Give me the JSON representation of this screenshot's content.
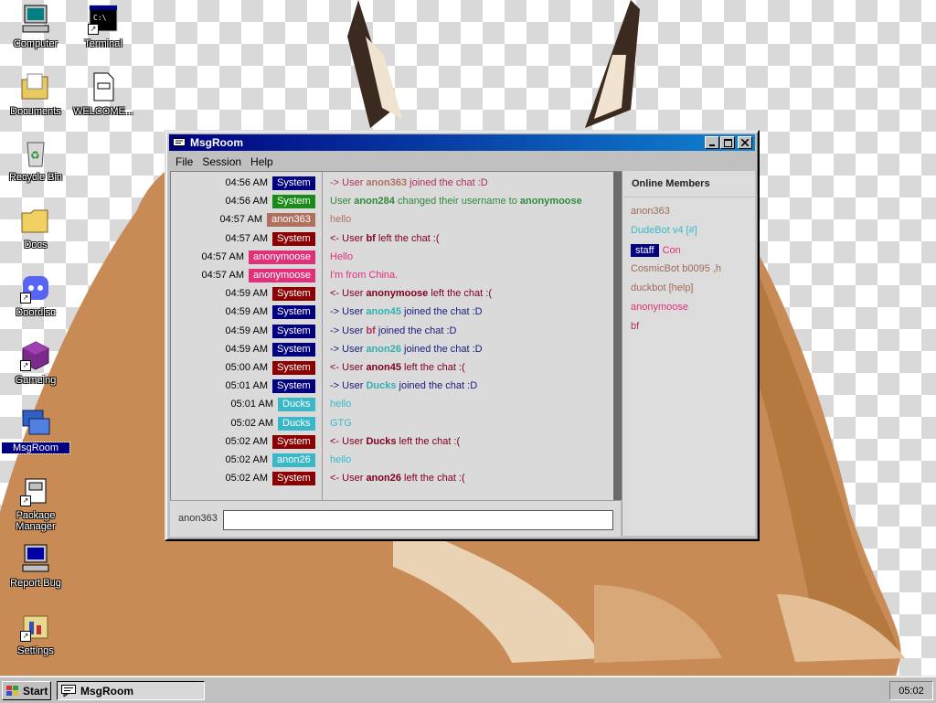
{
  "desktop": {
    "icons": [
      {
        "label": "Computer",
        "icon": "computer-icon",
        "shortcut": false
      },
      {
        "label": "Terminal",
        "icon": "terminal-icon",
        "shortcut": true
      },
      {
        "label": "Documents",
        "icon": "documents-folder-icon",
        "shortcut": false
      },
      {
        "label": "WELCOME...",
        "icon": "text-file-icon",
        "shortcut": false
      },
      {
        "label": "Recycle Bin",
        "icon": "recycle-bin-icon",
        "shortcut": false
      },
      {
        "label": "Docs",
        "icon": "folder-icon",
        "shortcut": false
      },
      {
        "label": "Doordisc",
        "icon": "doordisc-icon",
        "shortcut": true
      },
      {
        "label": "Gameing",
        "icon": "game-cube-icon",
        "shortcut": true
      },
      {
        "label": "MsgRoom",
        "icon": "msgroom-icon",
        "shortcut": false
      },
      {
        "label": "Package Manager",
        "icon": "package-manager-icon",
        "shortcut": true
      },
      {
        "label": "Report Bug",
        "icon": "report-bug-icon",
        "shortcut": false
      },
      {
        "label": "Settings",
        "icon": "settings-icon",
        "shortcut": true
      }
    ]
  },
  "window": {
    "title": "MsgRoom",
    "menu": [
      "File",
      "Session",
      "Help"
    ],
    "messages": [
      {
        "time": "04:56 AM",
        "user": "System",
        "badge_color": "#000080",
        "parts": [
          [
            "-> User ",
            "#b0305a",
            false
          ],
          [
            "anon363",
            "#b07060",
            true
          ],
          [
            " joined the chat :D",
            "#b0305a",
            false
          ]
        ]
      },
      {
        "time": "04:56 AM",
        "user": "System",
        "badge_color": "#1a8a1a",
        "parts": [
          [
            "User ",
            "#2e8b3a",
            false
          ],
          [
            "anon284",
            "#2e8b3a",
            true
          ],
          [
            " changed their username to ",
            "#2e8b3a",
            false
          ],
          [
            "anonymoose",
            "#2e8b3a",
            true
          ]
        ]
      },
      {
        "time": "04:57 AM",
        "user": "anon363",
        "badge_color": "#b07060",
        "parts": [
          [
            "hello",
            "#b07060",
            false
          ]
        ]
      },
      {
        "time": "04:57 AM",
        "user": "System",
        "badge_color": "#8b0000",
        "parts": [
          [
            "<- User ",
            "#800020",
            false
          ],
          [
            "bf",
            "#800020",
            true
          ],
          [
            " left the chat :(",
            "#800020",
            false
          ]
        ]
      },
      {
        "time": "04:57 AM",
        "user": "anonymoose",
        "badge_color": "#e0307a",
        "parts": [
          [
            "Hello",
            "#e0307a",
            false
          ]
        ]
      },
      {
        "time": "04:57 AM",
        "user": "anonymoose",
        "badge_color": "#e0307a",
        "parts": [
          [
            "I'm from China.",
            "#e0307a",
            false
          ]
        ]
      },
      {
        "time": "04:59 AM",
        "user": "System",
        "badge_color": "#8b0000",
        "parts": [
          [
            "<- User ",
            "#800020",
            false
          ],
          [
            "anonymoose",
            "#800020",
            true
          ],
          [
            " left the chat :(",
            "#800020",
            false
          ]
        ]
      },
      {
        "time": "04:59 AM",
        "user": "System",
        "badge_color": "#000080",
        "parts": [
          [
            "-> User ",
            "#1a1a80",
            false
          ],
          [
            "anon45",
            "#30b0b0",
            true
          ],
          [
            " joined the chat :D",
            "#1a1a80",
            false
          ]
        ]
      },
      {
        "time": "04:59 AM",
        "user": "System",
        "badge_color": "#000080",
        "parts": [
          [
            "-> User ",
            "#1a1a80",
            false
          ],
          [
            "bf",
            "#b0305a",
            true
          ],
          [
            " joined the chat :D",
            "#1a1a80",
            false
          ]
        ]
      },
      {
        "time": "04:59 AM",
        "user": "System",
        "badge_color": "#000080",
        "parts": [
          [
            "-> User ",
            "#1a1a80",
            false
          ],
          [
            "anon26",
            "#30b0b0",
            true
          ],
          [
            " joined the chat :D",
            "#1a1a80",
            false
          ]
        ]
      },
      {
        "time": "05:00 AM",
        "user": "System",
        "badge_color": "#8b0000",
        "parts": [
          [
            "<- User ",
            "#800020",
            false
          ],
          [
            "anon45",
            "#800020",
            true
          ],
          [
            " left the chat :(",
            "#800020",
            false
          ]
        ]
      },
      {
        "time": "05:01 AM",
        "user": "System",
        "badge_color": "#000080",
        "parts": [
          [
            "-> User ",
            "#1a1a80",
            false
          ],
          [
            "Ducks",
            "#30b0b0",
            true
          ],
          [
            " joined the chat :D",
            "#1a1a80",
            false
          ]
        ]
      },
      {
        "time": "05:01 AM",
        "user": "Ducks",
        "badge_color": "#3ab8c8",
        "parts": [
          [
            "hello",
            "#3ab8c8",
            false
          ]
        ]
      },
      {
        "time": "05:02 AM",
        "user": "Ducks",
        "badge_color": "#3ab8c8",
        "parts": [
          [
            "GTG",
            "#3ab8c8",
            false
          ]
        ]
      },
      {
        "time": "05:02 AM",
        "user": "System",
        "badge_color": "#8b0000",
        "parts": [
          [
            "<- User ",
            "#800020",
            false
          ],
          [
            "Ducks",
            "#800020",
            true
          ],
          [
            " left the chat :(",
            "#800020",
            false
          ]
        ]
      },
      {
        "time": "05:02 AM",
        "user": "anon26",
        "badge_color": "#3ab8c8",
        "parts": [
          [
            "hello",
            "#3ab8c8",
            false
          ]
        ]
      },
      {
        "time": "05:02 AM",
        "user": "System",
        "badge_color": "#8b0000",
        "parts": [
          [
            "<- User ",
            "#800020",
            false
          ],
          [
            "anon26",
            "#800020",
            true
          ],
          [
            " left the chat :(",
            "#800020",
            false
          ]
        ]
      }
    ],
    "input": {
      "nick": "anon363",
      "value": ""
    },
    "members": {
      "header": "Online Members",
      "list": [
        {
          "name": "anon363",
          "color": "#a06a5a",
          "badge": ""
        },
        {
          "name": "DudeBot v4 [#]",
          "color": "#3ab8c8",
          "badge": ""
        },
        {
          "name": "Con",
          "color": "#e0307a",
          "badge": "staff"
        },
        {
          "name": "CosmicBot b0095 ,h",
          "color": "#a06a5a",
          "badge": ""
        },
        {
          "name": "duckbot [help]",
          "color": "#a06a5a",
          "badge": ""
        },
        {
          "name": "anonymoose",
          "color": "#e0307a",
          "badge": ""
        },
        {
          "name": "bf",
          "color": "#b0305a",
          "badge": ""
        }
      ]
    }
  },
  "taskbar": {
    "start_label": "Start",
    "task_label": "MsgRoom",
    "clock": "05:02"
  }
}
